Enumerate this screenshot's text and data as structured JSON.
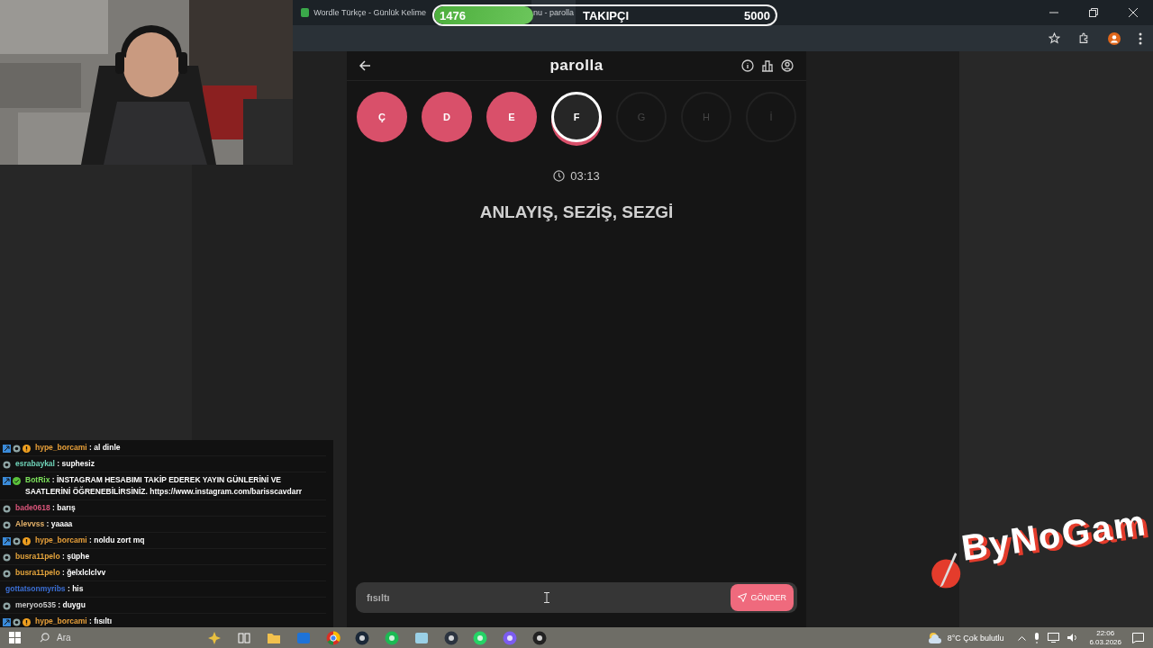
{
  "browser": {
    "tabs": [
      {
        "title": "Wordle Türkçe - Günlük Kelime",
        "selected": false
      },
      {
        "title": "nu - parolla",
        "selected": true
      }
    ]
  },
  "follower_goal": {
    "current": "1476",
    "label": "TAKIPÇI",
    "target": "5000",
    "level": 0.29
  },
  "game": {
    "title": "parolla",
    "letters": [
      {
        "letter": "Ç",
        "kind": "wrong"
      },
      {
        "letter": "D",
        "kind": "wrong"
      },
      {
        "letter": "E",
        "kind": "wrong"
      },
      {
        "letter": "F",
        "kind": "current"
      },
      {
        "letter": "G",
        "kind": "pending"
      },
      {
        "letter": "H",
        "kind": "pending"
      },
      {
        "letter": "İ",
        "kind": "pending"
      }
    ],
    "timer": "03:13",
    "clue": "ANLAYIŞ, SEZİŞ, SEZGİ",
    "answer": {
      "value": "fısıltı"
    },
    "submit": "GÖNDER"
  },
  "chat": [
    {
      "user": "hype_borcami",
      "color": "#e8a03a",
      "text": ": al dinle",
      "badges": [
        {
          "kind": "square"
        },
        {
          "kind": "ring"
        },
        {
          "kind": "alert"
        }
      ]
    },
    {
      "user": "esrabaykal",
      "color": "#6fd3b8",
      "text": ": suphesiz",
      "badges": [
        {
          "kind": "ring"
        }
      ]
    },
    {
      "user": "BotRix",
      "color": "#7be05a",
      "text": ": İNSTAGRAM HESABIMI TAKİP EDEREK YAYIN GÜNLERİNİ VE SAATLERİNİ ÖĞRENEBİLİRSİNİZ. https://www.instagram.com/barisscavdarr",
      "badges": [
        {
          "kind": "square"
        },
        {
          "kind": "check"
        }
      ]
    },
    {
      "user": "bade0618",
      "color": "#d9557a",
      "text": ": barış",
      "badges": [
        {
          "kind": "ring"
        }
      ]
    },
    {
      "user": "Alevvss",
      "color": "#e6b36a",
      "text": ": yaaaa",
      "badges": [
        {
          "kind": "ring"
        }
      ]
    },
    {
      "user": "hype_borcami",
      "color": "#e8a03a",
      "text": ": noldu zort mq",
      "badges": [
        {
          "kind": "square"
        },
        {
          "kind": "ring"
        },
        {
          "kind": "alert"
        }
      ]
    },
    {
      "user": "busra11pelo",
      "color": "#e6a53c",
      "text": ": şüphe",
      "badges": [
        {
          "kind": "ring"
        }
      ]
    },
    {
      "user": "busra11pelo",
      "color": "#e6a53c",
      "text": ": ğelxlclclvv",
      "badges": [
        {
          "kind": "ring"
        }
      ]
    },
    {
      "user": "gottatsonmyribs",
      "color": "#3b6fd6",
      "text": ": his"
    },
    {
      "user": "meryoo535",
      "color": "#c8c8c8",
      "text": ": duygu",
      "badges": [
        {
          "kind": "ring"
        }
      ]
    },
    {
      "user": "hype_borcami",
      "color": "#e8a03a",
      "text": ": fısıltı",
      "badges": [
        {
          "kind": "square"
        },
        {
          "kind": "ring"
        },
        {
          "kind": "alert"
        }
      ]
    }
  ],
  "logo": {
    "text": "ByNoGam"
  },
  "taskbar": {
    "search": {
      "placeholder": "Ara"
    },
    "weather": "8°C  Çok bulutlu",
    "time": "22:06",
    "date": "6.03.2026"
  }
}
